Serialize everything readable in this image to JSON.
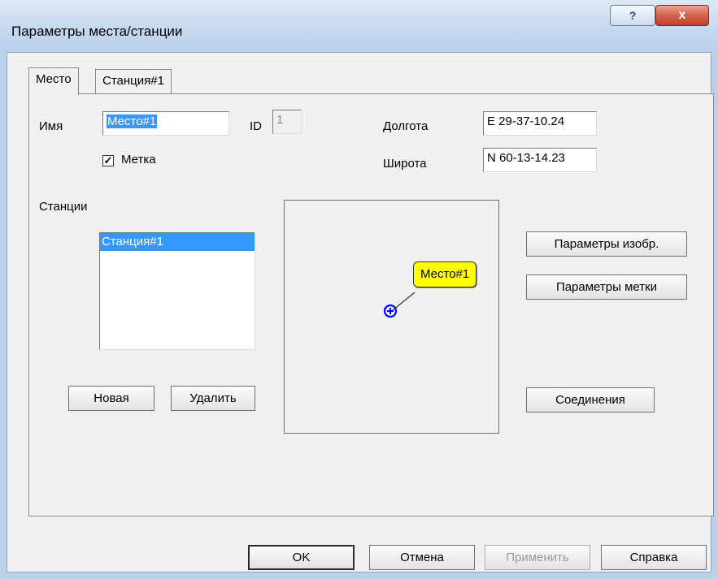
{
  "window": {
    "title": "Параметры места/станции",
    "help_glyph": "?",
    "close_glyph": "x"
  },
  "tabs": [
    {
      "label": "Место",
      "active": true
    },
    {
      "label": "Станция#1",
      "active": false
    }
  ],
  "place": {
    "name_label": "Имя",
    "name_value": "Место#1",
    "id_label": "ID",
    "id_value": "1",
    "mark_label": "Метка",
    "mark_checked": true,
    "longitude_label": "Долгота",
    "longitude_value": "E 29-37-10.24",
    "latitude_label": "Широта",
    "latitude_value": "N 60-13-14.23",
    "stations_label": "Станции",
    "stations": [
      "Станция#1"
    ],
    "new_button": "Новая",
    "delete_button": "Удалить"
  },
  "preview": {
    "marker_label": "Место#1",
    "marker_icon": "circle-plus-icon",
    "marker_color": "#0000ff",
    "label_bg": "#ffff00"
  },
  "side_buttons": {
    "image_params": "Параметры изобр.",
    "mark_params": "Параметры метки",
    "connections": "Соединения"
  },
  "footer": {
    "ok": "OK",
    "cancel": "Отмена",
    "apply": "Применить",
    "help": "Справка"
  }
}
